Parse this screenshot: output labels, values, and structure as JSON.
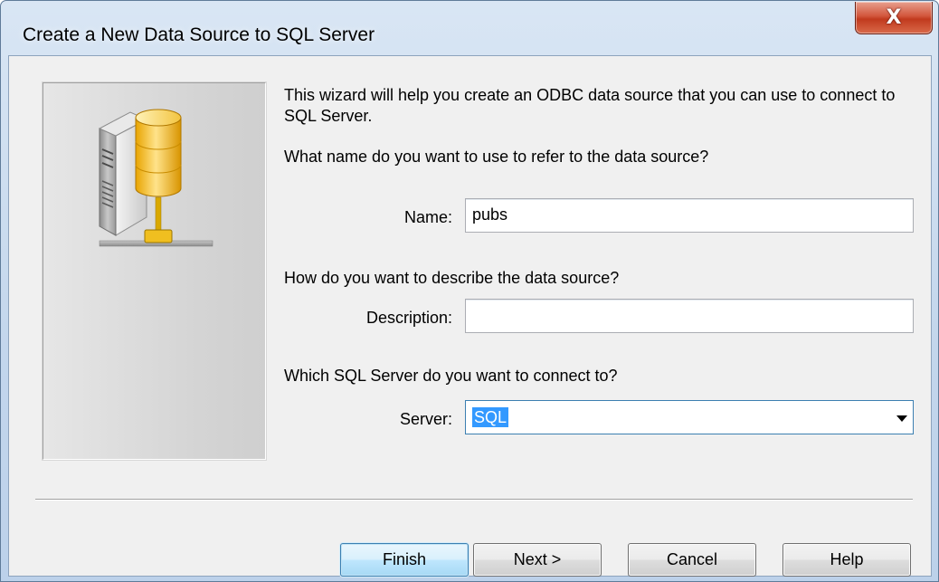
{
  "window": {
    "title": "Create a New Data Source to SQL Server",
    "close_glyph": "X",
    "close_icon": "close-icon"
  },
  "wizard": {
    "intro": "This wizard will help you create an ODBC data source that you can use to connect to SQL Server.",
    "name_question": "What name do you want to use to refer to the data source?",
    "name_label": "Name:",
    "name_value": "pubs",
    "description_question": "How do you want to describe the data source?",
    "description_label": "Description:",
    "description_value": "",
    "server_question": "Which SQL Server do you want to connect to?",
    "server_label": "Server:",
    "server_value": "SQL",
    "server_icon": "chevron-down-icon",
    "art_icon": "database-server-icon"
  },
  "buttons": {
    "finish": "Finish",
    "next": "Next >",
    "cancel": "Cancel",
    "help": "Help"
  },
  "colors": {
    "title_gradient_top": "#d9e6f4",
    "close_red": "#c13a1e",
    "selection_blue": "#3399ff",
    "focus_border": "#3c7fb1"
  }
}
